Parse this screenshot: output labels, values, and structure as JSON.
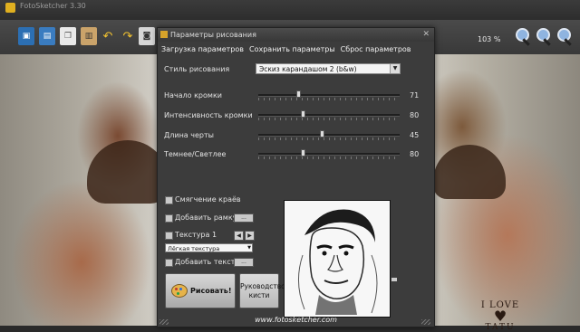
{
  "app": {
    "title": "FotoSketcher 3.30",
    "zoom": "103 %",
    "toolbar_icons": [
      "open-image-icon",
      "save-image-icon",
      "copy-icon",
      "paste-icon",
      "undo-icon",
      "redo-icon",
      "camera-icon"
    ],
    "zoom_icons": [
      "zoom-in-icon",
      "zoom-out-icon",
      "zoom-fit-icon"
    ]
  },
  "dialog": {
    "title": "Параметры рисования",
    "menu": [
      "Загрузка параметров",
      "Сохранить параметры",
      "Сброс параметров"
    ],
    "style_label": "Стиль рисования",
    "style_value": "Эскиз карандашом 2 (b&w)",
    "sliders": [
      {
        "label": "Начало кромки",
        "value": 71,
        "thumb": 0.28
      },
      {
        "label": "Интенсивность кромки",
        "value": 80,
        "thumb": 0.31
      },
      {
        "label": "Длина черты",
        "value": 45,
        "thumb": 0.45
      },
      {
        "label": "Темнее/Светлее",
        "value": 80,
        "thumb": 0.31
      }
    ],
    "checkboxes": {
      "smooth_edges": "Смягчение краёв",
      "add_frame": "Добавить рамку",
      "texture": "Текстура 1",
      "add_text": "Добавить текст"
    },
    "small_button_label": "...",
    "texture_value": "Лёгкая текстура",
    "draw_button": "Рисовать!",
    "guide_button_line1": "Руководство",
    "guide_button_line2": "кисти",
    "footer": "www.fotosketcher.com"
  },
  "canvas": {
    "tattoo_line1": "I LOVE",
    "tattoo_heart": "♥",
    "tattoo_line2": "TATU"
  },
  "colors": {
    "dialog_bg": "#3c3c3c",
    "toolbar_bg": "#404040",
    "accent": "#d5a22a"
  }
}
